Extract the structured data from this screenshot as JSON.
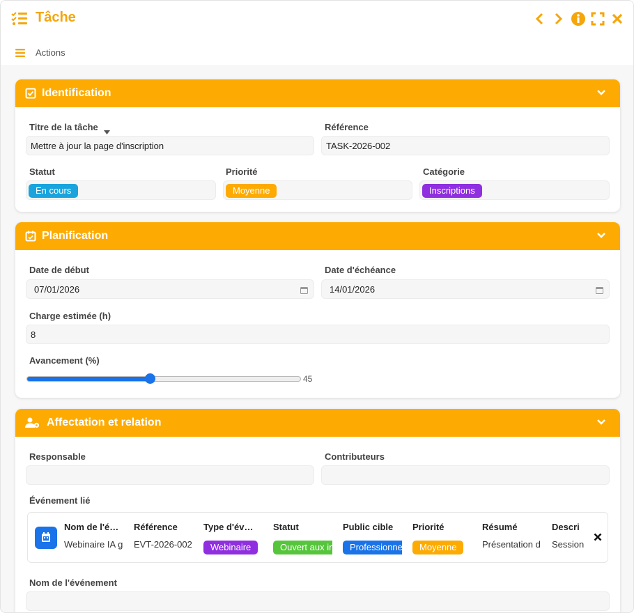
{
  "window": {
    "title": "Tâche",
    "actions_label": "Actions"
  },
  "colors": {
    "accent": "#fdab02",
    "title": "#f5a60b",
    "blue": "#1a73e8",
    "cyan": "#19a4de",
    "purple": "#8f2fe0",
    "green": "#56c53c"
  },
  "identification": {
    "title": "Identification",
    "titre_label": "Titre de la tâche",
    "titre_value": "Mettre à jour la page d'inscription",
    "reference_label": "Référence",
    "reference_value": "TASK-2026-002",
    "statut_label": "Statut",
    "statut_value": "En cours",
    "priorite_label": "Priorité",
    "priorite_value": "Moyenne",
    "categorie_label": "Catégorie",
    "categorie_value": "Inscriptions"
  },
  "planification": {
    "title": "Planification",
    "debut_label": "Date de début",
    "debut_value": "07/01/2026",
    "echeance_label": "Date d'échéance",
    "echeance_value": "14/01/2026",
    "charge_label": "Charge estimée (h)",
    "charge_value": "8",
    "avancement_label": "Avancement (%)",
    "avancement_value": 45,
    "avancement_text": "45"
  },
  "affectation": {
    "title": "Affectation et relation",
    "responsable_label": "Responsable",
    "responsable_value": "",
    "contributeurs_label": "Contributeurs",
    "contributeurs_value": "",
    "evenement_label": "Événement lié",
    "nom_evenement_label": "Nom de l'événement",
    "nom_evenement_value": "",
    "event": {
      "headers": [
        "Nom de l'é…",
        "Référence",
        "Type d'év…",
        "Statut",
        "Public cible",
        "Priorité",
        "Résumé",
        "Descri"
      ],
      "nom": "Webinaire IA g",
      "reference": "EVT-2026-002",
      "type": "Webinaire",
      "statut": "Ouvert aux in",
      "public": "Professionnels",
      "priorite": "Moyenne",
      "resume": "Présentation d",
      "description": "Session"
    }
  }
}
